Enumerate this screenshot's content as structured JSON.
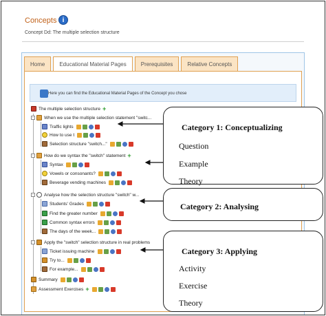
{
  "header": {
    "title": "Concepts",
    "info_icon": "i",
    "description": "Concept Dd: The multiple selection structure"
  },
  "tabs": [
    {
      "label": "Home"
    },
    {
      "label": "Educational Material Pages",
      "active": true
    },
    {
      "label": "Prerequisites"
    },
    {
      "label": "Relative Concepts"
    }
  ],
  "banner": {
    "text": "Here you can find the Educational Material Pages of the Concept you chose"
  },
  "tree": {
    "root": {
      "label": "The multiple selection structure",
      "icon": "house-icon"
    },
    "groups": [
      {
        "label": "When we use the multiple selection statement \"switc...",
        "icon": "folder-icon",
        "children": [
          {
            "label": "Traffic lights",
            "icon": "question-icon"
          },
          {
            "label": "How to use t",
            "icon": "bulb-icon"
          },
          {
            "label": "Selection structure \"switch...\"",
            "icon": "book-icon"
          }
        ]
      },
      {
        "label": "How do we syntax the \"switch\" statement",
        "icon": "folder-icon",
        "children": [
          {
            "label": "Syntax",
            "icon": "question-icon"
          },
          {
            "label": "Vowels or consonants?",
            "icon": "bulb-icon"
          },
          {
            "label": "Beverage vending machines",
            "icon": "book-icon"
          }
        ]
      },
      {
        "label": "Analyse how the selection structure \"switch\" w...",
        "icon": "circle-icon",
        "children": [
          {
            "label": "Students' Grades",
            "icon": "document-icon"
          },
          {
            "label": "Find the greater number",
            "icon": "flag-icon"
          },
          {
            "label": "Common syntax errors",
            "icon": "flag-icon"
          },
          {
            "label": "The days of the week...",
            "icon": "book-icon"
          }
        ]
      },
      {
        "label": "Apply the \"switch\" selection structure in real problems",
        "icon": "pen-icon",
        "children": [
          {
            "label": "Ticket issuing machine",
            "icon": "document-icon"
          },
          {
            "label": "Try to...",
            "icon": "pen-icon"
          },
          {
            "label": "For example...",
            "icon": "book-icon"
          }
        ]
      }
    ],
    "summary": {
      "label": "Summary",
      "icon": "pen-icon"
    },
    "assessment": {
      "label": "Assessment Exercises",
      "icon": "folder-icon"
    }
  },
  "callouts": [
    {
      "title": "Category 1: Conceptualizing",
      "items": [
        "Question",
        "Example",
        "Theory"
      ]
    },
    {
      "title": "Category 2: Analysing",
      "items": []
    },
    {
      "title": "Category 3: Applying",
      "items": [
        "Activity",
        "Exercise",
        "Theory"
      ]
    }
  ],
  "colors": {
    "heading": "#c06018",
    "tab_border": "#e0a050",
    "tab_fill": "#fbe4c4",
    "panel_border": "#9ec4e6",
    "banner_fill": "#e2eefa",
    "add_green": "#2a9a2a"
  }
}
